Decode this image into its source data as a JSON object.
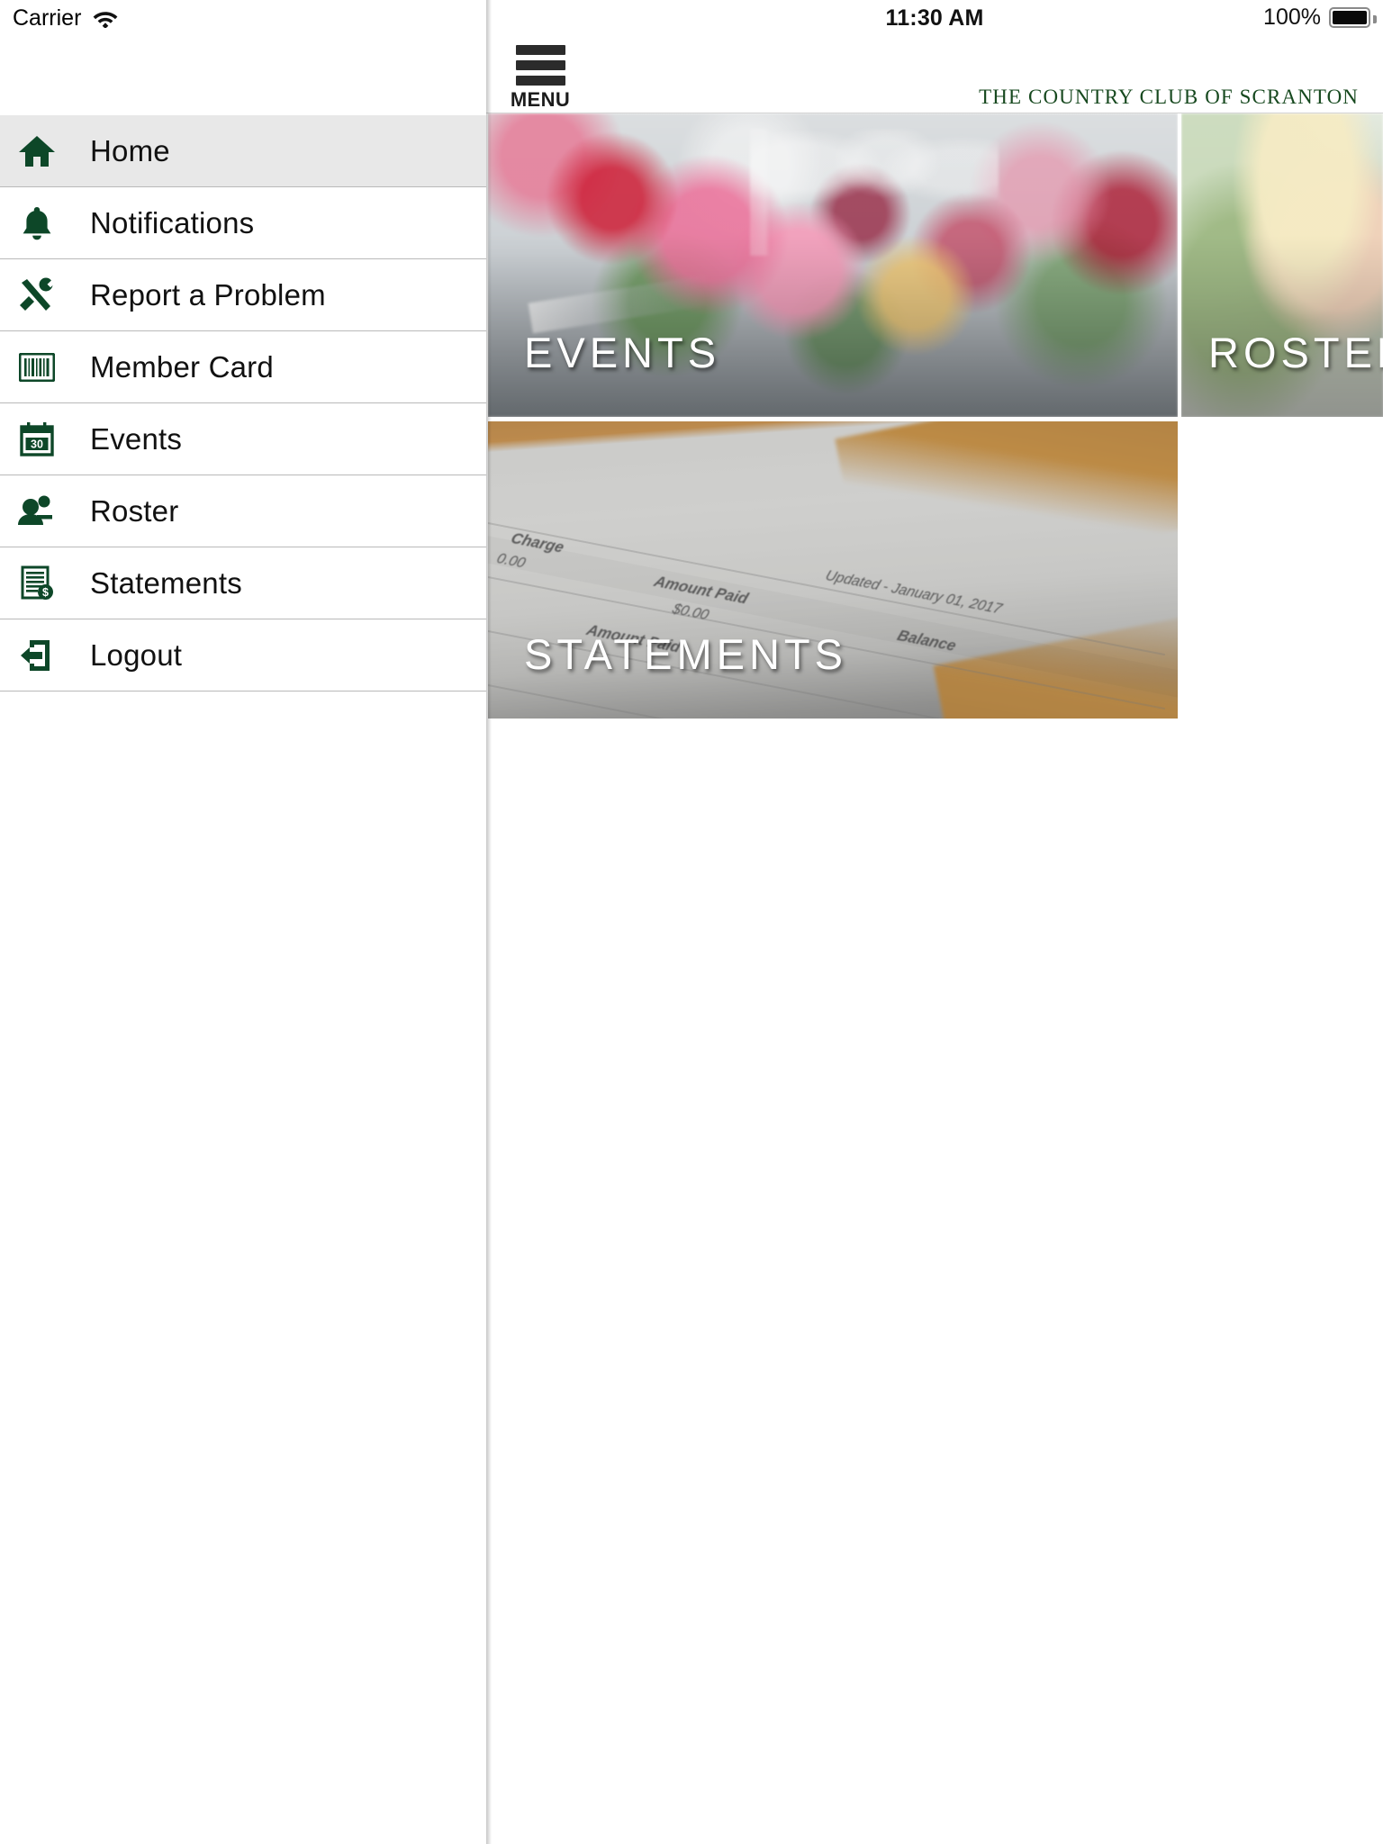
{
  "status_bar": {
    "carrier": "Carrier",
    "wifi_icon": "wifi-icon",
    "time": "11:30 AM",
    "battery_percent": "100%",
    "battery_icon": "battery-full-icon"
  },
  "header": {
    "menu_label": "MENU",
    "menu_icon": "hamburger-menu-icon",
    "club_title": "THE COUNTRY CLUB OF SCRANTON",
    "club_title_color": "#17491f"
  },
  "sidebar": {
    "items": [
      {
        "label": "Home",
        "icon": "home-icon",
        "active": true
      },
      {
        "label": "Notifications",
        "icon": "bell-icon",
        "active": false
      },
      {
        "label": "Report a Problem",
        "icon": "tools-icon",
        "active": false
      },
      {
        "label": "Member Card",
        "icon": "barcode-card-icon",
        "active": false
      },
      {
        "label": "Events",
        "icon": "calendar-30-icon",
        "active": false
      },
      {
        "label": "Roster",
        "icon": "people-icon",
        "active": false
      },
      {
        "label": "Statements",
        "icon": "document-dollar-icon",
        "active": false
      },
      {
        "label": "Logout",
        "icon": "logout-arrow-icon",
        "active": false
      }
    ],
    "icon_color": "#0d4728",
    "active_row_color": "#e8e8e8"
  },
  "main": {
    "tiles": [
      {
        "label": "EVENTS",
        "image": "floral-table-setting-photo"
      },
      {
        "label": "ROSTER",
        "image": "golfer-in-cap-photo"
      },
      {
        "label": "STATEMENTS",
        "image": "paper-statement-on-desk-photo"
      }
    ]
  },
  "statement_photo_text": {
    "charge": "Charge",
    "charge_amount": "0.00",
    "amount_paid_1": "Amount Paid",
    "amount_paid_1_value": "$0.00",
    "amount_paid_2": "Amount Paid",
    "updated": "Updated - January 01, 2017",
    "balance": "Balance"
  }
}
